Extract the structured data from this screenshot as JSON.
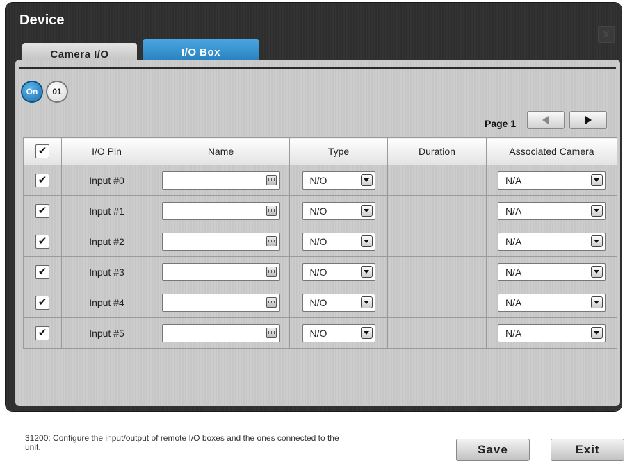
{
  "window": {
    "title": "Device",
    "close_label": "X"
  },
  "tabs": [
    {
      "label": "Camera I/O",
      "active": false
    },
    {
      "label": "I/O Box",
      "active": true
    }
  ],
  "badges": {
    "on": "On",
    "unit": "01"
  },
  "pagination": {
    "label": "Page 1"
  },
  "table": {
    "headers": [
      "I/O Pin",
      "Name",
      "Type",
      "Duration",
      "Associated Camera"
    ],
    "rows": [
      {
        "checked": "✔",
        "pin": "Input #0",
        "name": "",
        "type": "N/O",
        "duration": "",
        "camera": "N/A"
      },
      {
        "checked": "✔",
        "pin": "Input #1",
        "name": "",
        "type": "N/O",
        "duration": "",
        "camera": "N/A"
      },
      {
        "checked": "✔",
        "pin": "Input #2",
        "name": "",
        "type": "N/O",
        "duration": "",
        "camera": "N/A"
      },
      {
        "checked": "✔",
        "pin": "Input #3",
        "name": "",
        "type": "N/O",
        "duration": "",
        "camera": "N/A"
      },
      {
        "checked": "✔",
        "pin": "Input #4",
        "name": "",
        "type": "N/O",
        "duration": "",
        "camera": "N/A"
      },
      {
        "checked": "✔",
        "pin": "Input #5",
        "name": "",
        "type": "N/O",
        "duration": "",
        "camera": "N/A"
      }
    ],
    "header_check": "✔"
  },
  "footer": {
    "message": "31200: Configure the input/output of remote I/O boxes and the ones connected to the unit.",
    "save_label": "Save",
    "exit_label": "Exit"
  },
  "colors": {
    "accent": "#2f8ccd",
    "window_bg": "#303030",
    "panel_bg": "#c9c9c9"
  }
}
